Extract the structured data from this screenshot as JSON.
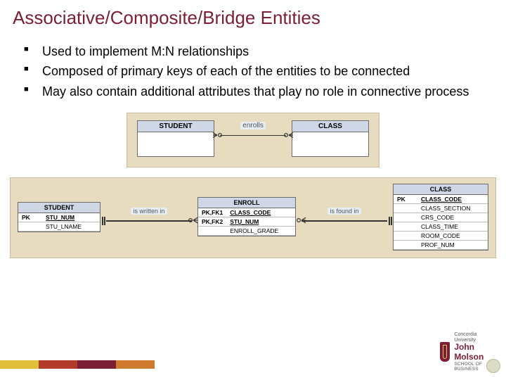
{
  "title": "Associative/Composite/Bridge Entities",
  "bullets": [
    "Used to implement M:N relationships",
    "Composed of primary keys of each of the entities to be connected",
    "May also contain additional attributes that play no role in connective process"
  ],
  "top": {
    "left_entity": "STUDENT",
    "right_entity": "CLASS",
    "relation": "enrolls"
  },
  "bottom": {
    "student": {
      "name": "STUDENT",
      "rows": [
        {
          "key": "PK",
          "attr": "STU_NUM",
          "ul": true
        },
        {
          "key": "",
          "attr": "STU_LNAME",
          "sep": true
        }
      ]
    },
    "rel1": "is written in",
    "enroll": {
      "name": "ENROLL",
      "rows": [
        {
          "key": "PK,FK1",
          "attr": "CLASS_CODE",
          "ul": true
        },
        {
          "key": "PK,FK2",
          "attr": "STU_NUM",
          "ul": true
        },
        {
          "key": "",
          "attr": "ENROLL_GRADE",
          "sep": true
        }
      ]
    },
    "rel2": "is found in",
    "class": {
      "name": "CLASS",
      "rows": [
        {
          "key": "PK",
          "attr": "CLASS_CODE",
          "ul": true
        },
        {
          "key": "",
          "attr": "CLASS_SECTION",
          "sep": true
        },
        {
          "key": "",
          "attr": "CRS_CODE"
        },
        {
          "key": "",
          "attr": "CLASS_TIME"
        },
        {
          "key": "",
          "attr": "ROOM_CODE"
        },
        {
          "key": "",
          "attr": "PROF_NUM"
        }
      ]
    }
  },
  "footer": {
    "university": "Concordia University",
    "school1": "John Molson",
    "school2": "SCHOOL OF BUSINESS"
  }
}
